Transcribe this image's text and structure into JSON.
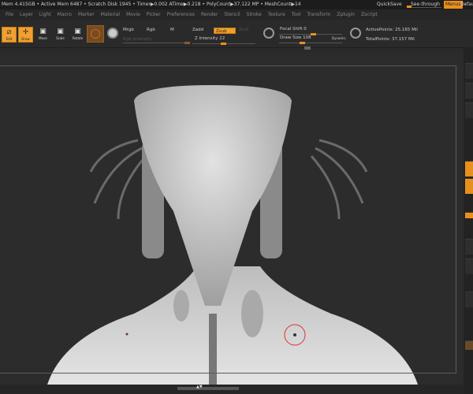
{
  "status": {
    "info": "Mem 4.415GB • Active Mem 6487 • Scratch Disk 1945 •  Timer▶0.002 ATime▶0.218 • PolyCount▶37.122 MP  • MeshCount▶14",
    "quicksave": "QuickSave",
    "see_through": "See-through  0",
    "menus": "Menus",
    "default": "Defau"
  },
  "menu": [
    "File",
    "Layer",
    "Light",
    "Macro",
    "Marker",
    "Material",
    "Movie",
    "Picker",
    "Preferences",
    "Render",
    "Stencil",
    "Stroke",
    "Texture",
    "Tool",
    "Transform",
    "Zplugin",
    "Zscript"
  ],
  "toolbar": {
    "edit": "Edit",
    "draw": "Draw",
    "move": "Move",
    "scale": "Scale",
    "rotate": "Rotate",
    "mrgb": "Mrgb",
    "rgb": "Rgb",
    "m": "M",
    "rgb_intensity": "Rgb Intensity",
    "zadd": "Zadd",
    "zsub": "Zsub",
    "zcut": "Zcut",
    "z_intensity": "Z Intensity 22",
    "focal_shift": "Focal Shift 0",
    "draw_size": "Draw Size 108",
    "dynamic": "Dynamic",
    "active_points": "ActivePoints: 25.165 Mil",
    "total_points": "TotalPoints: 37.157 Mil",
    "z_intensity_value": 22,
    "focal_shift_value": 0,
    "draw_size_value": 108
  },
  "colors": {
    "accent": "#f0a030",
    "bg": "#2c2c2c"
  }
}
